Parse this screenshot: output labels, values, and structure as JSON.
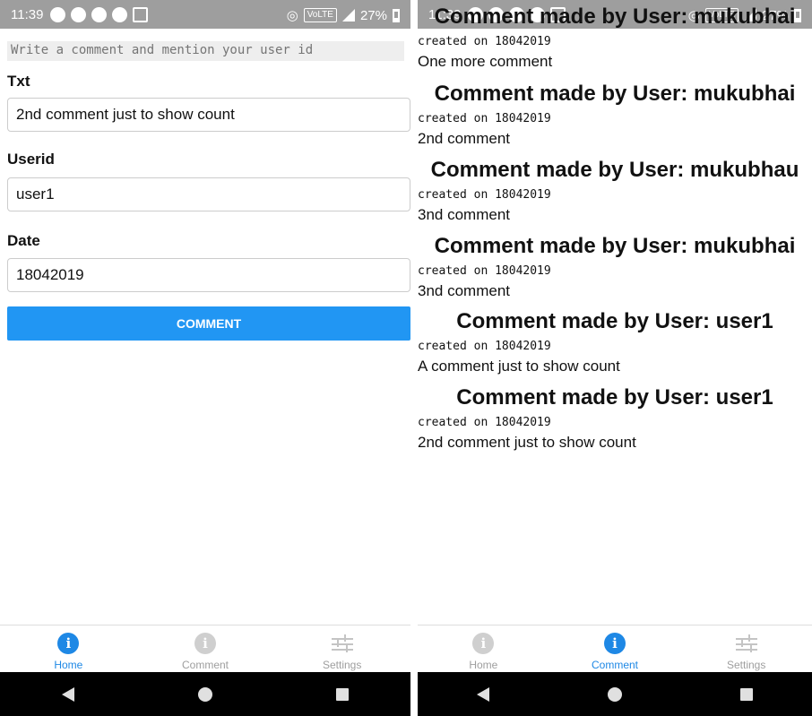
{
  "status_bar": {
    "time": "11:39",
    "volte": "VoLTE",
    "network": "4G",
    "battery": "27%"
  },
  "form": {
    "hint": "Write a comment and mention your user id",
    "txt_label": "Txt",
    "txt_value": "2nd comment just to show count",
    "userid_label": "Userid",
    "userid_value": "user1",
    "date_label": "Date",
    "date_value": "18042019",
    "submit_label": "COMMENT"
  },
  "comments": [
    {
      "title": "Comment made by User: mukubhai",
      "created": "created on 18042019",
      "text": "One more comment"
    },
    {
      "title": "Comment made by User: mukubhai",
      "created": "created on 18042019",
      "text": "2nd comment"
    },
    {
      "title": "Comment made by User: mukubhau",
      "created": "created on 18042019",
      "text": "3nd comment"
    },
    {
      "title": "Comment made by User: mukubhai",
      "created": "created on 18042019",
      "text": "3nd comment"
    },
    {
      "title": "Comment made by User: user1",
      "created": "created on 18042019",
      "text": "A comment just to show count"
    },
    {
      "title": "Comment made by User: user1",
      "created": "created on 18042019",
      "text": "2nd comment just to show count"
    }
  ],
  "tabs": {
    "home": "Home",
    "comment": "Comment",
    "settings": "Settings"
  },
  "colors": {
    "accent": "#2196f3",
    "status_bar": "#9e9e9e",
    "tab_active": "#1e88e5",
    "nav_bar": "#000000"
  }
}
